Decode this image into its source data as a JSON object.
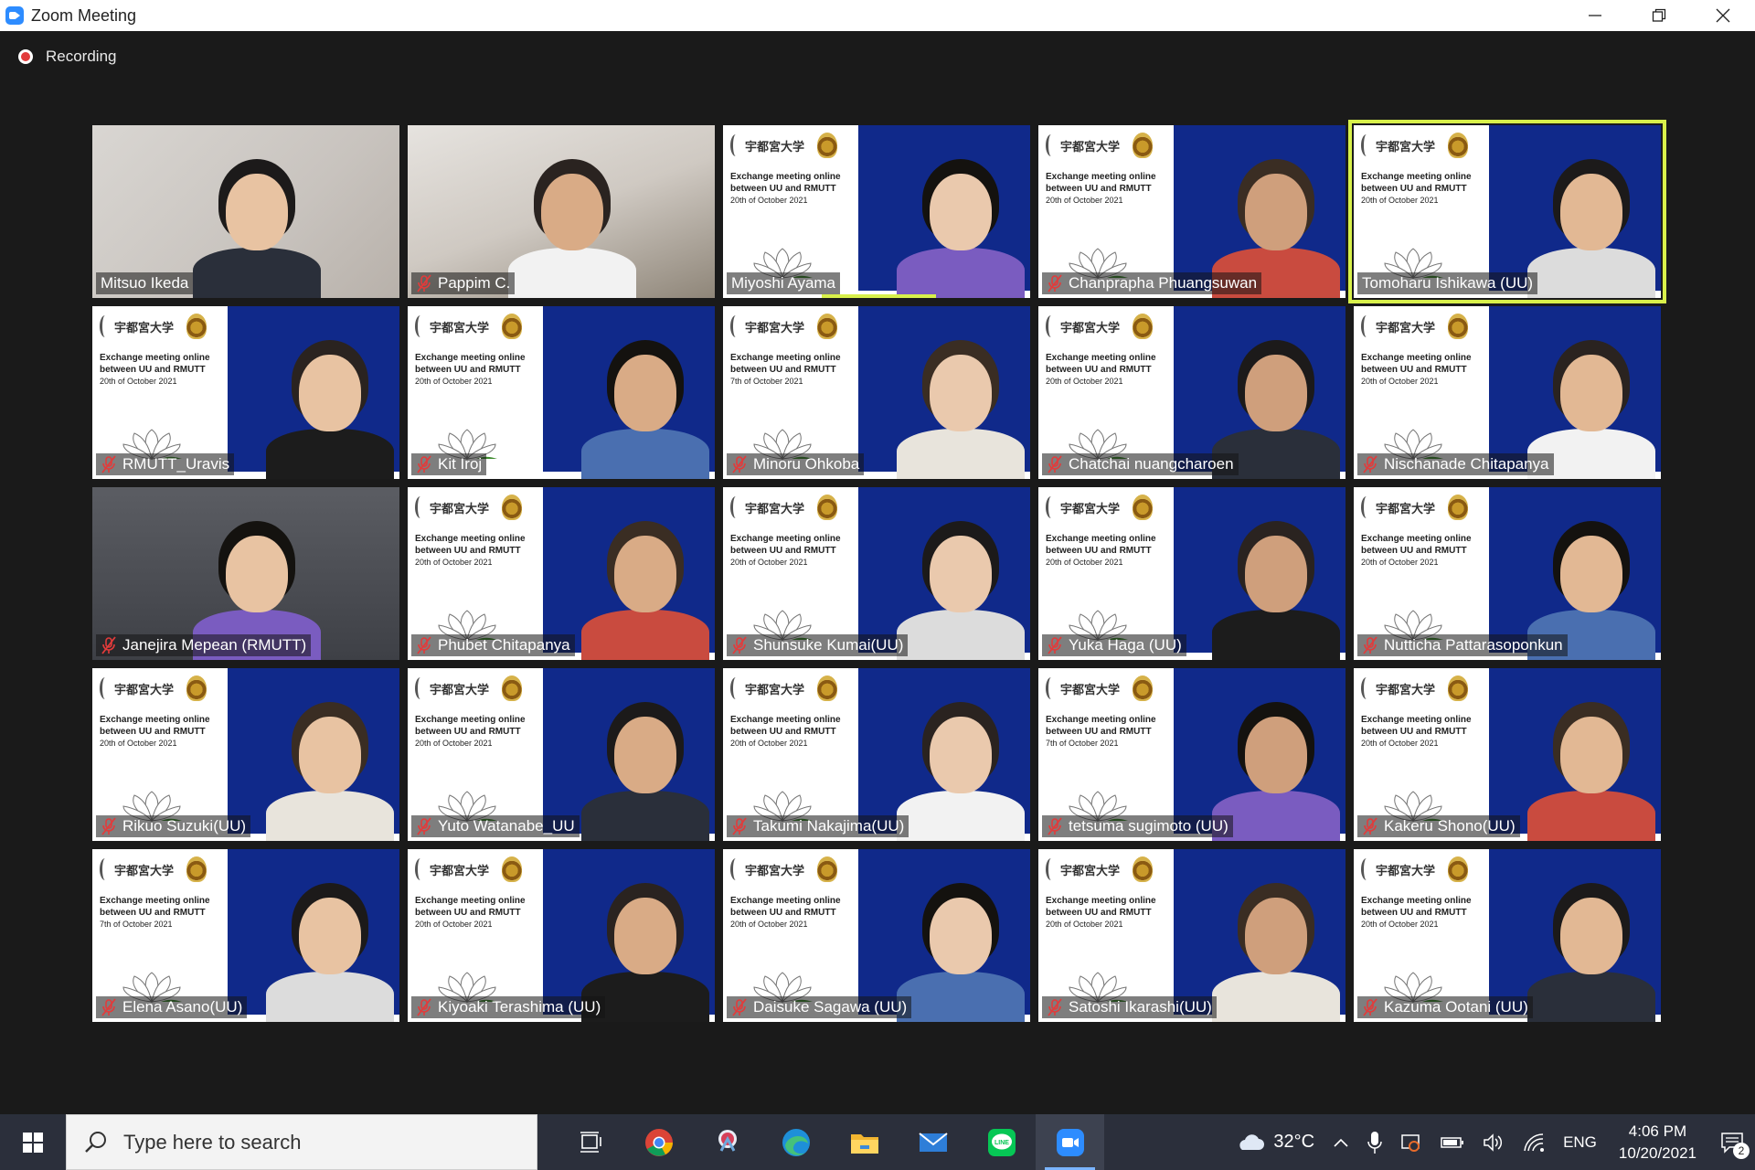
{
  "window": {
    "title": "Zoom Meeting",
    "minimize_label": "—",
    "restore_label": "❐",
    "close_label": "✕"
  },
  "recording": {
    "label": "Recording"
  },
  "slide_text": {
    "uni": "宇都宮大学",
    "line1": "Exchange meeting online",
    "line2": "between UU and RMUTT",
    "date_20": "20th of October 2021",
    "date_7": "7th of October 2021"
  },
  "participants": [
    {
      "name": "Mitsuo Ikeda",
      "muted": false,
      "bg": "room"
    },
    {
      "name": "Pappim C.",
      "muted": true,
      "bg": "room2"
    },
    {
      "name": "Miyoshi Ayama",
      "muted": false,
      "bg": "slide",
      "speaking": true
    },
    {
      "name": "Chanprapha Phuangsuwan",
      "muted": true,
      "bg": "slide"
    },
    {
      "name": "Tomoharu Ishikawa (UU)",
      "muted": false,
      "bg": "slide",
      "active": true
    },
    {
      "name": "RMUTT_Uravis",
      "muted": true,
      "bg": "slide"
    },
    {
      "name": "Kit Iroj",
      "muted": true,
      "bg": "slide"
    },
    {
      "name": "Minoru Ohkoba",
      "muted": true,
      "bg": "slide",
      "date7": true
    },
    {
      "name": "Chatchai nuangcharoen",
      "muted": true,
      "bg": "slide"
    },
    {
      "name": "Nischanade Chitapanya",
      "muted": true,
      "bg": "slide"
    },
    {
      "name": "Janejira Mepean (RMUTT)",
      "muted": true,
      "bg": "dark"
    },
    {
      "name": "Phubet Chitapanya",
      "muted": true,
      "bg": "slide"
    },
    {
      "name": "Shunsuke Kumai(UU)",
      "muted": true,
      "bg": "slide"
    },
    {
      "name": "Yuka Haga (UU)",
      "muted": true,
      "bg": "slide"
    },
    {
      "name": "Nutticha Pattarasoponkun",
      "muted": true,
      "bg": "slide"
    },
    {
      "name": "Rikuo Suzuki(UU)",
      "muted": true,
      "bg": "slide"
    },
    {
      "name": "Yuto Watanabe_UU",
      "muted": true,
      "bg": "slide"
    },
    {
      "name": "Takumi Nakajima(UU)",
      "muted": true,
      "bg": "slide"
    },
    {
      "name": "tetsuma sugimoto (UU)",
      "muted": true,
      "bg": "slide",
      "date7": true
    },
    {
      "name": "Kakeru Shono(UU)",
      "muted": true,
      "bg": "slide"
    },
    {
      "name": "Elena Asano(UU)",
      "muted": true,
      "bg": "slide",
      "date7": true
    },
    {
      "name": "Kiyoaki Terashima (UU)",
      "muted": true,
      "bg": "slide"
    },
    {
      "name": "Daisuke Sagawa (UU)",
      "muted": true,
      "bg": "slide"
    },
    {
      "name": "Satoshi Ikarashi(UU)",
      "muted": true,
      "bg": "slide"
    },
    {
      "name": "Kazuma Ootani (UU)",
      "muted": true,
      "bg": "slide"
    }
  ],
  "taskbar": {
    "search_placeholder": "Type here to search",
    "apps": [
      "task-view-icon",
      "chrome-icon",
      "snip-icon",
      "edge-icon",
      "file-explorer-icon",
      "mail-icon",
      "line-icon",
      "zoom-icon"
    ],
    "weather_temp": "32°C",
    "language": "ENG",
    "time": "4:06 PM",
    "date": "10/20/2021",
    "notification_count": "2"
  },
  "colors": {
    "zoom_blue": "#2D8CFF",
    "active_speaker": "#d8f04b",
    "slide_navy": "#10298a",
    "recording_red": "#e23b3b",
    "taskbar": "#2b2f3b"
  }
}
